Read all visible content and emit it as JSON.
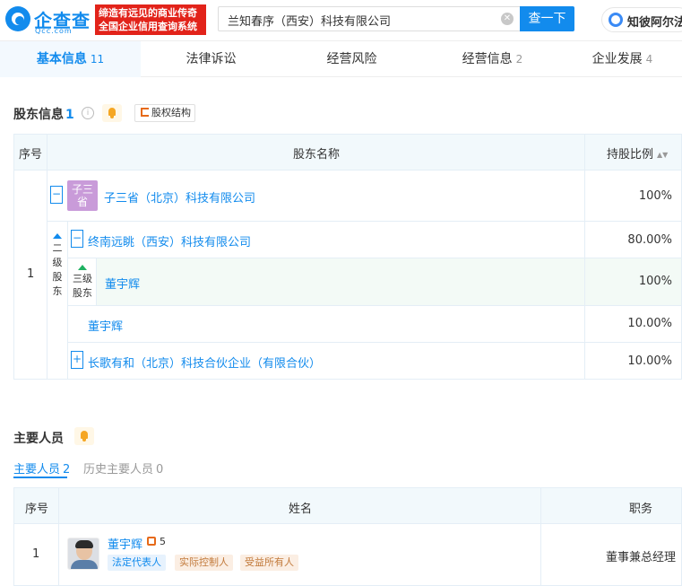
{
  "header": {
    "logo_text": "企查查",
    "logo_sub": "Qcc.com",
    "slogan_line1": "缔造有远见的商业传奇",
    "slogan_line2": "全国企业信用查询系统",
    "search_value": "兰知春序（西安）科技有限公司",
    "search_button": "查一下",
    "zhibo_label": "知彼阿尔法"
  },
  "tabs": [
    {
      "label": "基本信息",
      "count": "11"
    },
    {
      "label": "法律诉讼",
      "count": ""
    },
    {
      "label": "经营风险",
      "count": ""
    },
    {
      "label": "经营信息",
      "count": "2"
    },
    {
      "label": "企业发展",
      "count": "4"
    }
  ],
  "shareholders": {
    "title": "股东信息",
    "count": "1",
    "equity_button": "股权结构",
    "col_index": "序号",
    "col_name": "股东名称",
    "col_ratio": "持股比例",
    "row_index": "1",
    "level2_label": [
      "二",
      "级",
      "股",
      "东"
    ],
    "level3_label": [
      "三级",
      "股东"
    ],
    "main": {
      "avatar": "子三省",
      "name": "子三省（北京）科技有限公司",
      "ratio": "100%"
    },
    "sub1": {
      "name": "终南远眺（西安）科技有限公司",
      "ratio": "80.00%"
    },
    "sub1_child": {
      "name": "董宇辉",
      "ratio": "100%"
    },
    "sub2": {
      "name": "董宇辉",
      "ratio": "10.00%"
    },
    "sub3": {
      "name": "长歌有和（北京）科技合伙企业（有限合伙）",
      "ratio": "10.00%"
    }
  },
  "people": {
    "title": "主要人员",
    "tab_current": "主要人员",
    "tab_current_count": "2",
    "tab_history": "历史主要人员",
    "tab_history_count": "0",
    "col_index": "序号",
    "col_name": "姓名",
    "col_role": "职务",
    "row_index": "1",
    "name": "董宇辉",
    "relation_count": "5",
    "tags": [
      "法定代表人",
      "实际控制人",
      "受益所有人"
    ],
    "role": "董事兼总经理"
  }
}
